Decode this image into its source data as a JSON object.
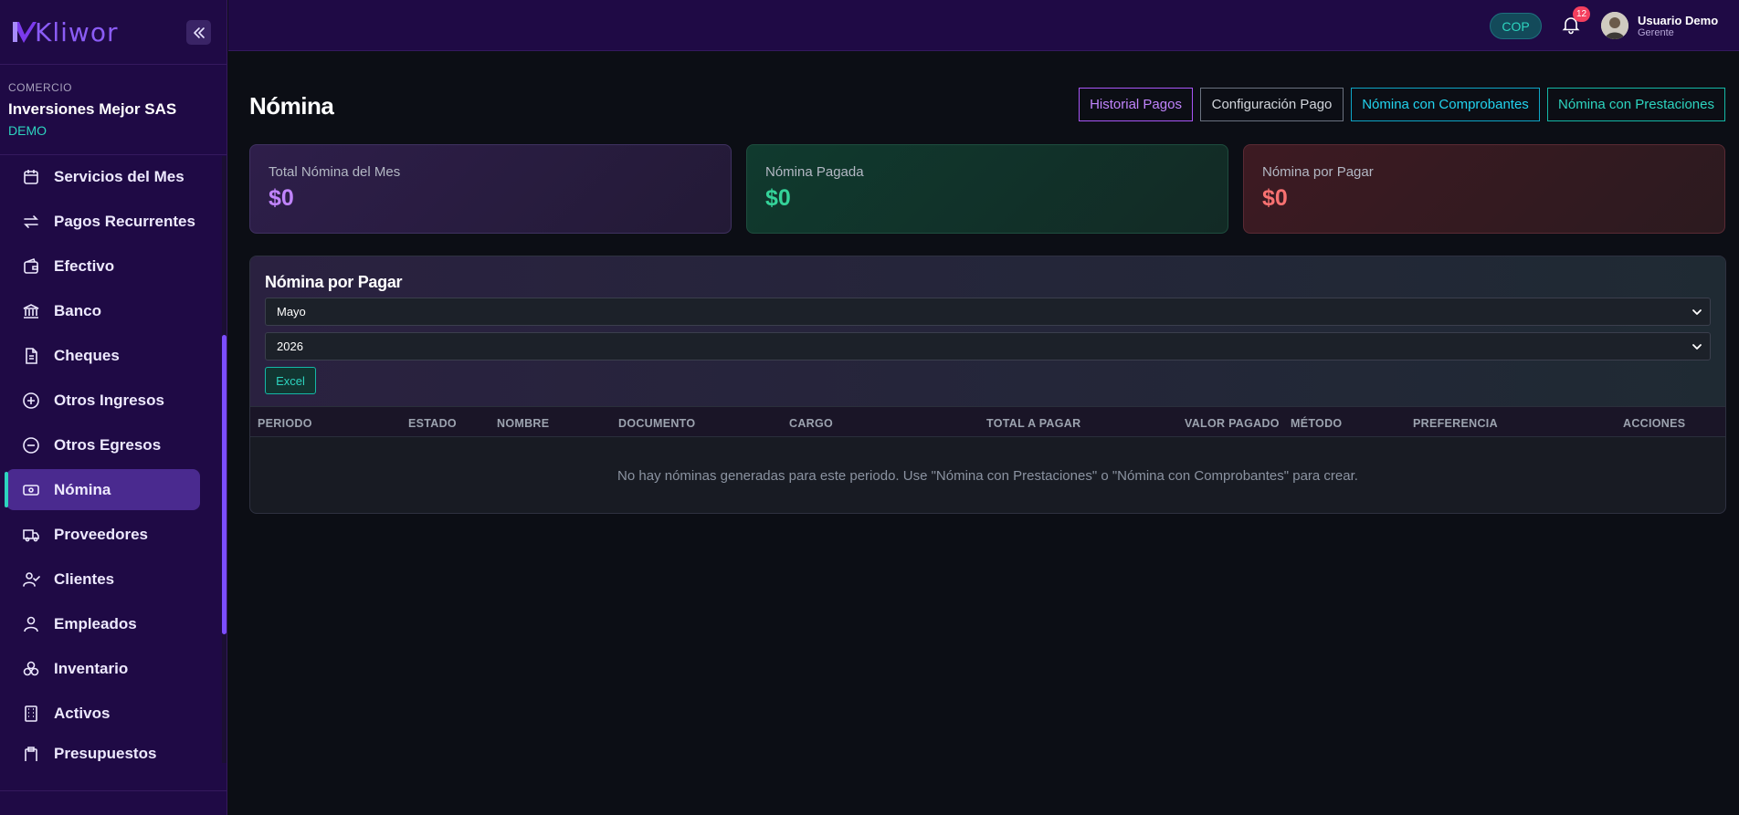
{
  "app": {
    "logo_text": "Kliwor"
  },
  "company": {
    "label": "COMERCIO",
    "name": "Inversiones Mejor SAS",
    "plan": "DEMO"
  },
  "sidebar": {
    "items": [
      {
        "label": "Servicios del Mes",
        "icon": "calendar-icon"
      },
      {
        "label": "Pagos Recurrentes",
        "icon": "repeat-icon"
      },
      {
        "label": "Efectivo",
        "icon": "wallet-icon"
      },
      {
        "label": "Banco",
        "icon": "bank-icon"
      },
      {
        "label": "Cheques",
        "icon": "document-icon"
      },
      {
        "label": "Otros Ingresos",
        "icon": "plus-circle-icon"
      },
      {
        "label": "Otros Egresos",
        "icon": "minus-circle-icon"
      },
      {
        "label": "Nómina",
        "icon": "banknote-icon",
        "active": true
      },
      {
        "label": "Proveedores",
        "icon": "truck-icon"
      },
      {
        "label": "Clientes",
        "icon": "user-check-icon"
      },
      {
        "label": "Empleados",
        "icon": "user-icon"
      },
      {
        "label": "Inventario",
        "icon": "boxes-icon"
      },
      {
        "label": "Activos",
        "icon": "building-icon"
      },
      {
        "label": "Presupuestos",
        "icon": "clipboard-icon"
      }
    ]
  },
  "topbar": {
    "currency": "COP",
    "notifications_count": "12",
    "user_name": "Usuario Demo",
    "user_role": "Gerente"
  },
  "page": {
    "title": "Nómina",
    "actions": {
      "historial": "Historial Pagos",
      "configuracion": "Configuración Pago",
      "comprobantes": "Nómina con Comprobantes",
      "prestaciones": "Nómina con Prestaciones"
    }
  },
  "cards": {
    "total": {
      "label": "Total Nómina del Mes",
      "value": "$0"
    },
    "paid": {
      "label": "Nómina Pagada",
      "value": "$0"
    },
    "due": {
      "label": "Nómina por Pagar",
      "value": "$0"
    }
  },
  "panel": {
    "title": "Nómina por Pagar",
    "month": "Mayo",
    "year": "2026",
    "excel_label": "Excel",
    "columns": [
      "PERIODO",
      "ESTADO",
      "NOMBRE",
      "DOCUMENTO",
      "CARGO",
      "TOTAL A PAGAR",
      "VALOR PAGADO",
      "MÉTODO",
      "PREFERENCIA",
      "ACCIONES"
    ],
    "empty_message": "No hay nóminas generadas para este periodo. Use \"Nómina con Prestaciones\" o \"Nómina con Comprobantes\" para crear."
  },
  "colors": {
    "sidebar_bg": "#1f0a45",
    "accent_purple": "#8b5cf6",
    "accent_teal": "#2dd4bf",
    "badge_red": "#f43f5e"
  }
}
